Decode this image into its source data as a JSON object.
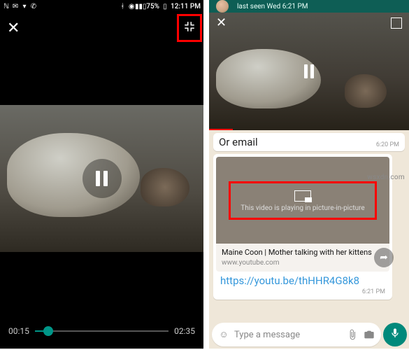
{
  "left": {
    "statusbar": {
      "battery_pct": "75%",
      "clock": "12:11 PM"
    },
    "close_label": "✕",
    "minimize_label": "✥",
    "video": {
      "position": "00:15",
      "duration": "02:35"
    }
  },
  "right": {
    "contact": {
      "last_seen": "last seen Wed 6:21 PM"
    },
    "messages": {
      "prev": {
        "text": "Or email",
        "time": "6:20 PM"
      },
      "link_preview": {
        "pip_text": "This video is playing in picture-in-picture",
        "title": "Maine Coon | Mother talking with her kittens",
        "domain": "www.youtube.com"
      },
      "link_url": "https://youtu.be/thHHR4G8k8",
      "link_time": "6:21 PM"
    },
    "input": {
      "placeholder": "Type a message"
    }
  },
  "watermark": "wsxdn.com"
}
